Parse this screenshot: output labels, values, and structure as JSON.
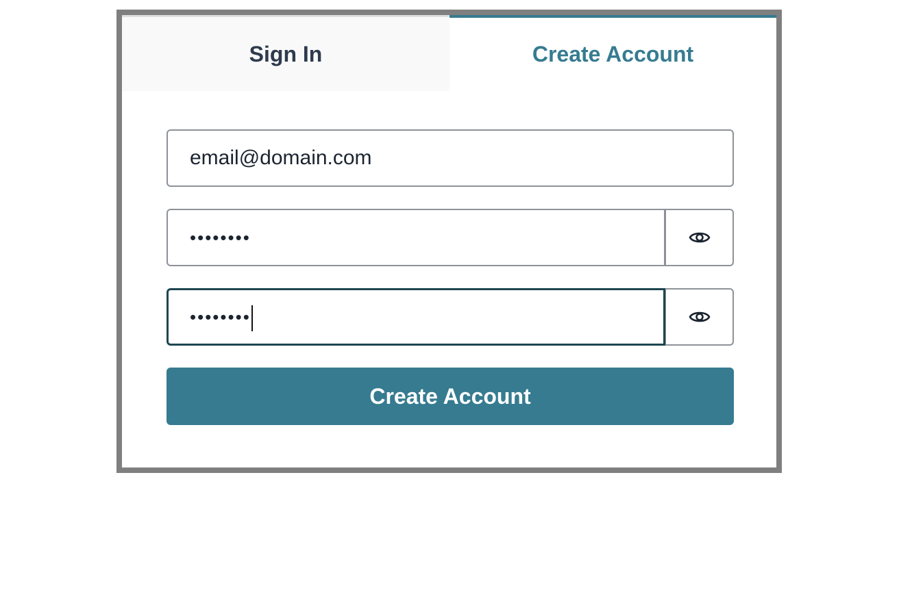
{
  "tabs": [
    {
      "label": "Sign In",
      "active": false
    },
    {
      "label": "Create Account",
      "active": true
    }
  ],
  "form": {
    "email_value": "email@domain.com",
    "password_value": "••••••••",
    "confirm_password_value": "••••••••",
    "submit_label": "Create Account"
  },
  "icons": {
    "show_password": "eye-icon"
  },
  "colors": {
    "accent": "#367b90",
    "frame_border": "#7f7f7f",
    "focus_border": "#1d4650",
    "inactive_tab_bg": "#f9f9f9",
    "inactive_tab_text": "#2e3a4d"
  }
}
